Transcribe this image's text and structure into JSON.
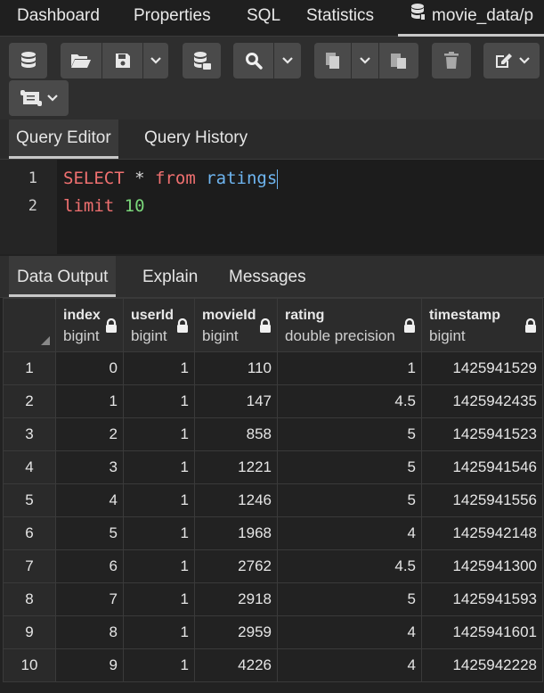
{
  "top_tabs": [
    {
      "label": "Dashboard"
    },
    {
      "label": "Properties"
    },
    {
      "label": "SQL"
    },
    {
      "label": "Statistics"
    },
    {
      "label": "movie_data/p"
    }
  ],
  "query_tabs": [
    {
      "label": "Query Editor"
    },
    {
      "label": "Query History"
    }
  ],
  "editor": {
    "line_numbers": [
      "1",
      "2"
    ],
    "line1": {
      "kw1": "SELECT",
      "star": "*",
      "kw2": "from",
      "ident": "ratings"
    },
    "line2": {
      "kw": "limit",
      "num": "10"
    }
  },
  "output_tabs": [
    {
      "label": "Data Output"
    },
    {
      "label": "Explain"
    },
    {
      "label": "Messages"
    }
  ],
  "columns": [
    {
      "name": "index",
      "type": "bigint"
    },
    {
      "name": "userId",
      "type": "bigint"
    },
    {
      "name": "movieId",
      "type": "bigint"
    },
    {
      "name": "rating",
      "type": "double precision"
    },
    {
      "name": "timestamp",
      "type": "bigint"
    }
  ],
  "rows": [
    [
      "1",
      "0",
      "1",
      "110",
      "1",
      "1425941529"
    ],
    [
      "2",
      "1",
      "1",
      "147",
      "4.5",
      "1425942435"
    ],
    [
      "3",
      "2",
      "1",
      "858",
      "5",
      "1425941523"
    ],
    [
      "4",
      "3",
      "1",
      "1221",
      "5",
      "1425941546"
    ],
    [
      "5",
      "4",
      "1",
      "1246",
      "5",
      "1425941556"
    ],
    [
      "6",
      "5",
      "1",
      "1968",
      "4",
      "1425942148"
    ],
    [
      "7",
      "6",
      "1",
      "2762",
      "4.5",
      "1425941300"
    ],
    [
      "8",
      "7",
      "1",
      "2918",
      "5",
      "1425941593"
    ],
    [
      "9",
      "8",
      "1",
      "2959",
      "4",
      "1425941601"
    ],
    [
      "10",
      "9",
      "1",
      "4226",
      "4",
      "1425942228"
    ]
  ],
  "icons": {
    "toolbar": [
      "database-icon",
      "folder-open-icon",
      "save-icon",
      "chevron-down-icon",
      "database-stack-icon",
      "search-icon",
      "chevron-down-icon",
      "copy-icon",
      "chevron-down-icon",
      "paste-icon",
      "trash-icon",
      "edit-icon",
      "chevron-down-icon",
      "scroll-icon",
      "chevron-down-icon"
    ],
    "column_lock": "lock-icon"
  },
  "colors": {
    "keyword": "#f07070",
    "identifier": "#6eb5f0",
    "number": "#7ad67a",
    "background": "#222222"
  }
}
